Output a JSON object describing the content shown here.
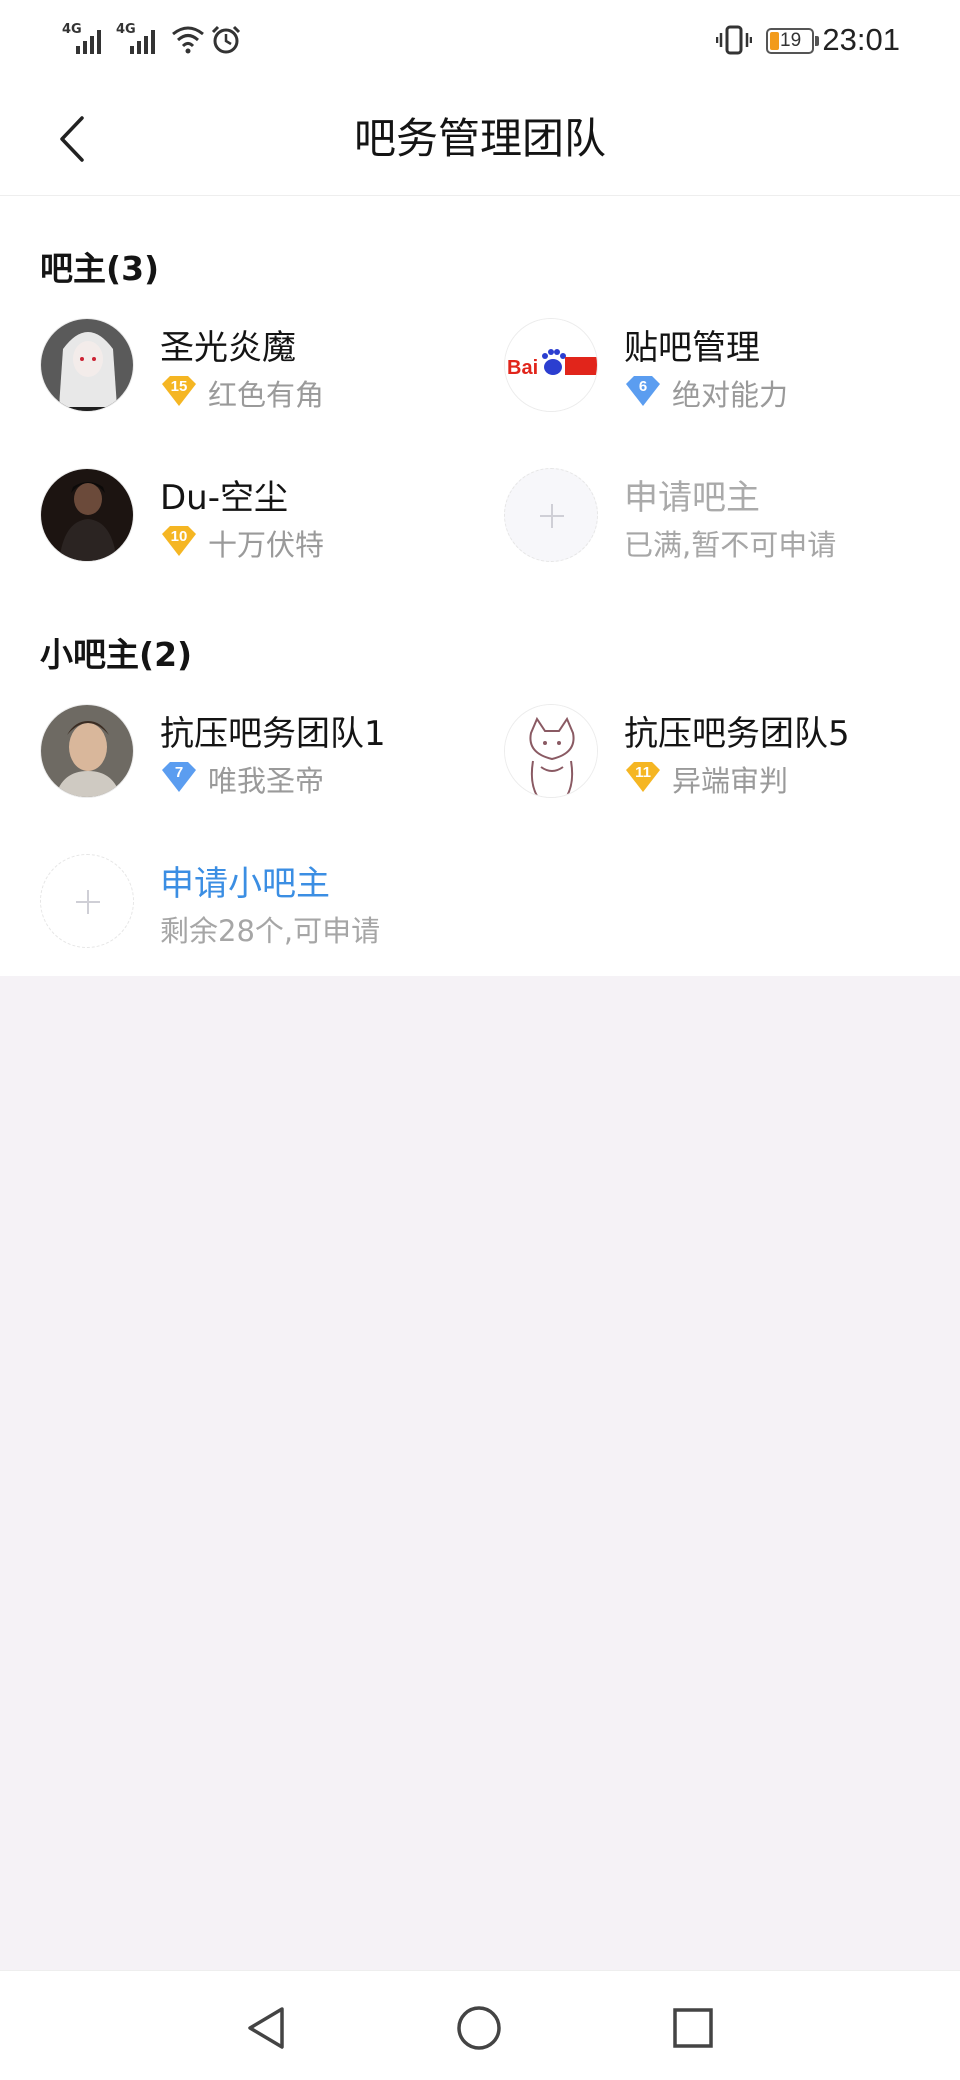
{
  "status_bar": {
    "sim1_label": "4G",
    "sim2_label": "4G",
    "battery_level": "19",
    "time": "23:01"
  },
  "nav": {
    "title": "吧务管理团队"
  },
  "owners": {
    "heading": "吧主(3)",
    "members": [
      {
        "name": "圣光炎魔",
        "level": "15",
        "level_color": "#f5b623",
        "title": "红色有角"
      },
      {
        "name": "贴吧管理",
        "level": "6",
        "level_color": "#5b9df0",
        "title": "绝对能力"
      },
      {
        "name": "Du-空尘",
        "level": "10",
        "level_color": "#f5b623",
        "title": "十万伏特"
      }
    ],
    "apply": {
      "label": "申请吧主",
      "note": "已满,暂不可申请"
    }
  },
  "assistants": {
    "heading": "小吧主(2)",
    "members": [
      {
        "name": "抗压吧务团队1",
        "level": "7",
        "level_color": "#5b9df0",
        "title": "唯我圣帝"
      },
      {
        "name": "抗压吧务团队5",
        "level": "11",
        "level_color": "#f5b623",
        "title": "异端审判"
      }
    ],
    "apply": {
      "label": "申请小吧主",
      "note": "剩余28个,可申请"
    }
  },
  "colors": {
    "accent_blue": "#3b8ee3",
    "page_background": "#f5f2f6"
  },
  "icons": {
    "back": "chevron-left-icon",
    "nav_back": "triangle-back-icon",
    "nav_home": "circle-home-icon",
    "nav_recents": "square-recents-icon"
  }
}
